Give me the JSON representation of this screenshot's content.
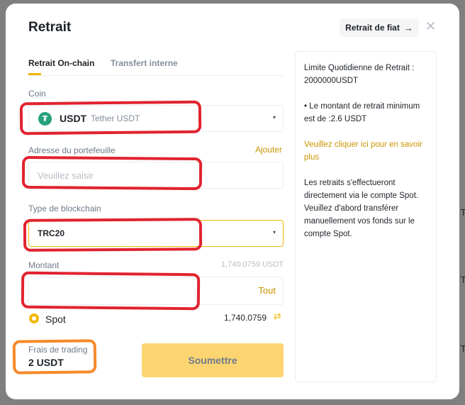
{
  "modal": {
    "title": "Retrait",
    "fiat_button": "Retrait de fiat",
    "fiat_arrow": "→",
    "close_glyph": "✕"
  },
  "tabs": [
    {
      "label": "Retrait On-chain",
      "active": true
    },
    {
      "label": "Transfert interne",
      "active": false
    }
  ],
  "coin": {
    "label": "Coin",
    "badge": "₮",
    "symbol": "USDT",
    "name": "Tether USDT",
    "caret": "▾"
  },
  "address": {
    "label": "Adresse du portefeuille",
    "add_link": "Ajouter",
    "placeholder": "Veuillez saisir"
  },
  "chain": {
    "label": "Type de blockchain",
    "value": "TRC20",
    "caret": "▾"
  },
  "amount": {
    "label": "Montant",
    "available": "1,740.0759 USDT",
    "all_button": "Tout"
  },
  "wallet": {
    "label": "Spot",
    "amount": "1,740.0759",
    "swap_glyph": "⇄"
  },
  "fee": {
    "label": "Frais de trading",
    "value": "2 USDT"
  },
  "submit_label": "Soumettre",
  "info": {
    "limit": "Limite Quotidienne de Retrait : 2000000USDT",
    "minimum": "• Le montant de retrait minimum est de :2.6 USDT",
    "link": "Veuillez cliquer ici pour en savoir plus",
    "note": "Les retraits s'effectueront directement via le compte Spot. Veuillez d'abord transférer manuellement vos fonds sur le compte Spot."
  },
  "background_edge_glyph": "T",
  "colors": {
    "accent": "#f0b90b",
    "link": "#c99400",
    "submit_disabled": "#fcd571",
    "annotation_red": "#e1232f",
    "annotation_orange": "#f5892a",
    "tether_green": "#26a17b"
  }
}
